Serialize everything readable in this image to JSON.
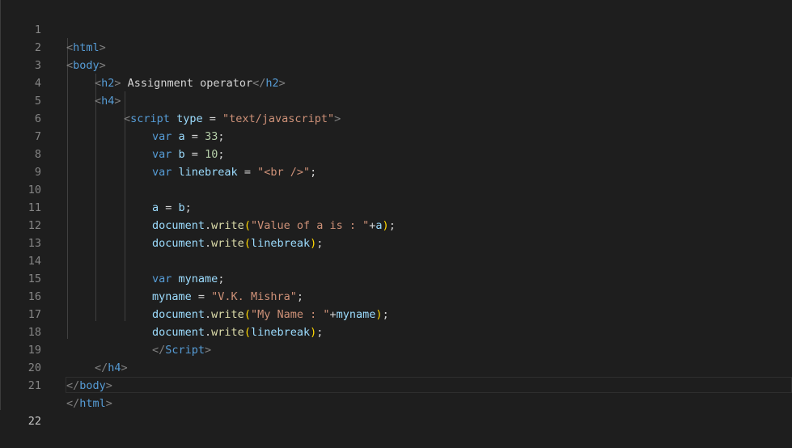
{
  "editor": {
    "line_numbers": [
      "1",
      "2",
      "3",
      "4",
      "5",
      "6",
      "7",
      "8",
      "9",
      "10",
      "11",
      "12",
      "13",
      "14",
      "15",
      "16",
      "17",
      "18",
      "19",
      "20",
      "21",
      "22"
    ],
    "current_line": "22"
  },
  "tokens": {
    "html": "html",
    "body": "body",
    "h2": "h2",
    "h2_text": " Assignment operator",
    "h4": "h4",
    "script": "script",
    "type_attr": "type",
    "eq": " = ",
    "type_val": "\"text/javascript\"",
    "var": "var",
    "a": "a",
    "b": "b",
    "linebreak": "linebreak",
    "myname": "myname",
    "n33": "33",
    "n10": "10",
    "br_str": "\"<br />\"",
    "document": "document",
    "write": "write",
    "val_a_str": "\"Value of a is : \"",
    "name_val": "\"V.K. Mishra\"",
    "my_name_str": "\"My Name : \"",
    "Script_close": "Script"
  }
}
